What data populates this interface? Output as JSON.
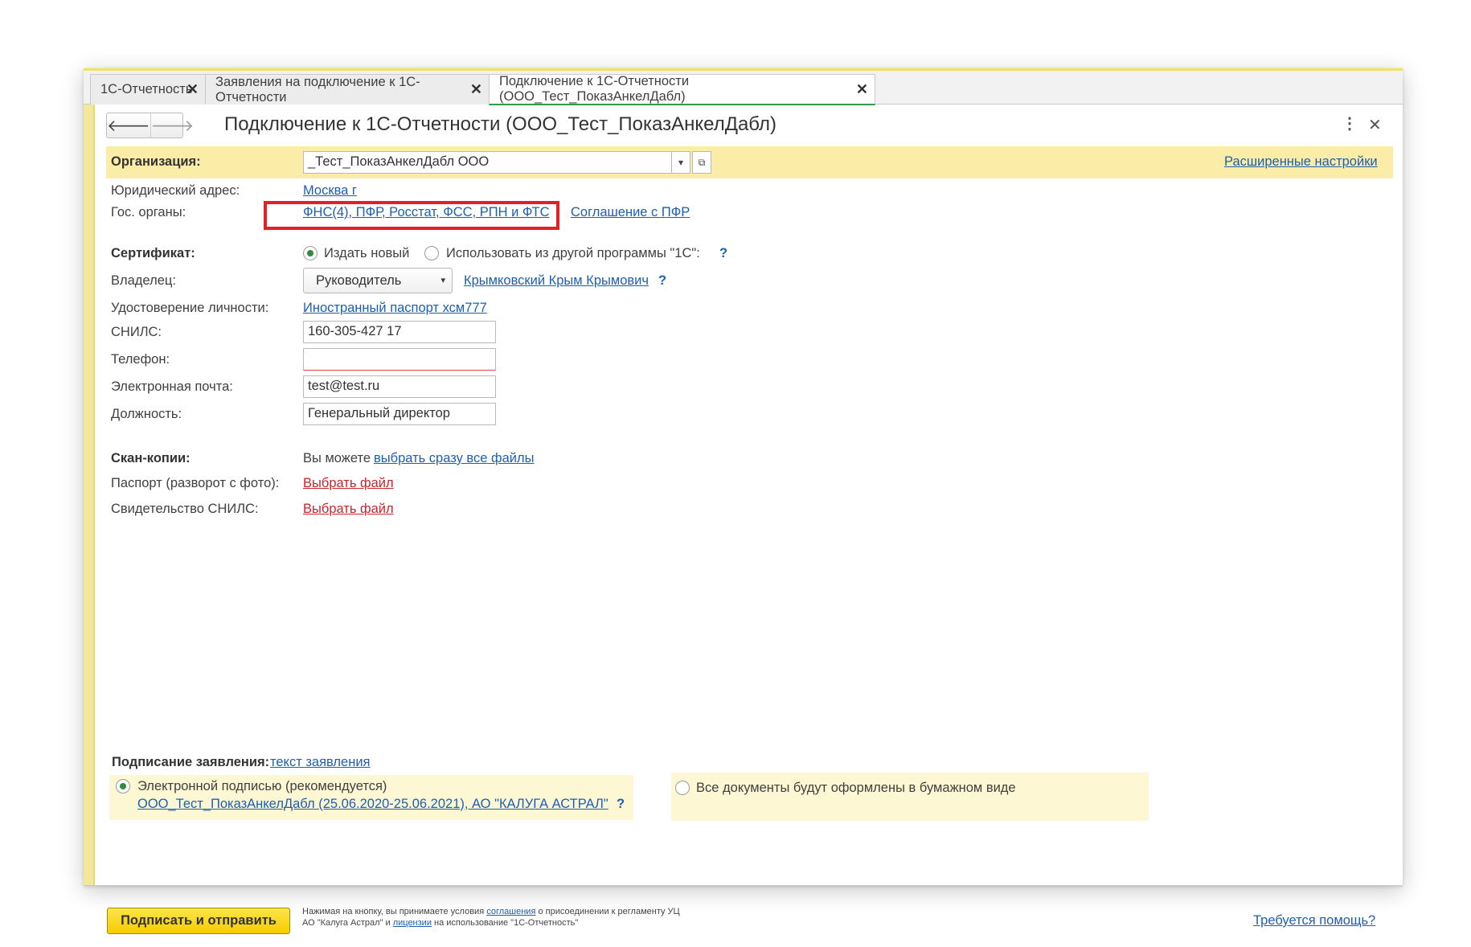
{
  "tabs": [
    {
      "label": "1С-Отчетность"
    },
    {
      "label": "Заявления на подключение к 1С-Отчетности"
    },
    {
      "label": "Подключение к 1С-Отчетности (ООО_Тест_ПоказАнкелДабл)"
    }
  ],
  "header": {
    "title": "Подключение к 1С-Отчетности (ООО_Тест_ПоказАнкелДабл)",
    "back_icon": "arrow-left-icon",
    "forward_icon": "arrow-right-icon",
    "more_icon": "more-vertical-icon",
    "close_icon": "close-icon"
  },
  "organization": {
    "label": "Организация:",
    "value": "_Тест_ПоказАнкелДабл ООО",
    "advanced_link": "Расширенные настройки"
  },
  "legal_address": {
    "label": "Юридический адрес:",
    "value": "Москва г"
  },
  "gov_bodies": {
    "label": "Гос. органы:",
    "value": "ФНС(4), ПФР, Росстат, ФСС, РПН и ФТС",
    "agreement_link": "Соглашение с ПФР"
  },
  "certificate": {
    "label": "Сертификат:",
    "option_new": "Издать новый",
    "option_other": "Использовать из другой программы \"1С\":",
    "help": "?"
  },
  "owner": {
    "label": "Владелец:",
    "role": "Руководитель",
    "person": "Крымковский Крым Крымович",
    "help": "?"
  },
  "identity": {
    "label": "Удостоверение личности:",
    "value": "Иностранный паспорт хсм777"
  },
  "snils": {
    "label": "СНИЛС:",
    "value": "160-305-427 17"
  },
  "phone": {
    "label": "Телефон:",
    "value": ""
  },
  "email": {
    "label": "Электронная почта:",
    "value": "test@test.ru"
  },
  "position": {
    "label": "Должность:",
    "value": "Генеральный директор"
  },
  "scans": {
    "label": "Скан-копии:",
    "prefix": "Вы можете",
    "select_all_link": "выбрать сразу все файлы",
    "passport_label": "Паспорт (разворот с фото):",
    "passport_link": "Выбрать файл",
    "snils_label": "Свидетельство СНИЛС:",
    "snils_link": "Выбрать файл"
  },
  "signing": {
    "label": "Подписание заявления:",
    "text_link": "текст заявления",
    "electronic_option": "Электронной подписью (рекомендуется)",
    "electronic_detail": "ООО_Тест_ПоказАнкелДабл (25.06.2020-25.06.2021), АО \"КАЛУГА АСТРАЛ\"",
    "electronic_help": "?",
    "paper_option": "Все документы будут оформлены в бумажном виде"
  },
  "footer": {
    "submit_label": "Подписать и отправить",
    "terms_line1_a": "Нажимая на кнопку, вы принимаете условия",
    "terms_link1": "соглашения",
    "terms_line1_b": "о присоединении к регламенту УЦ",
    "terms_line2_a": "АО \"Калуга Астрал\" и",
    "terms_link2": "лицензии",
    "terms_line2_b": "на использование \"1С-Отчетность\"",
    "help_link": "Требуется помощь?"
  },
  "colors": {
    "accent_yellow": "#fbeda7",
    "button_yellow": "#f4cc00",
    "link_blue": "#1d5fb0",
    "error_red": "#e3202a",
    "active_green": "#2e9a4a"
  }
}
